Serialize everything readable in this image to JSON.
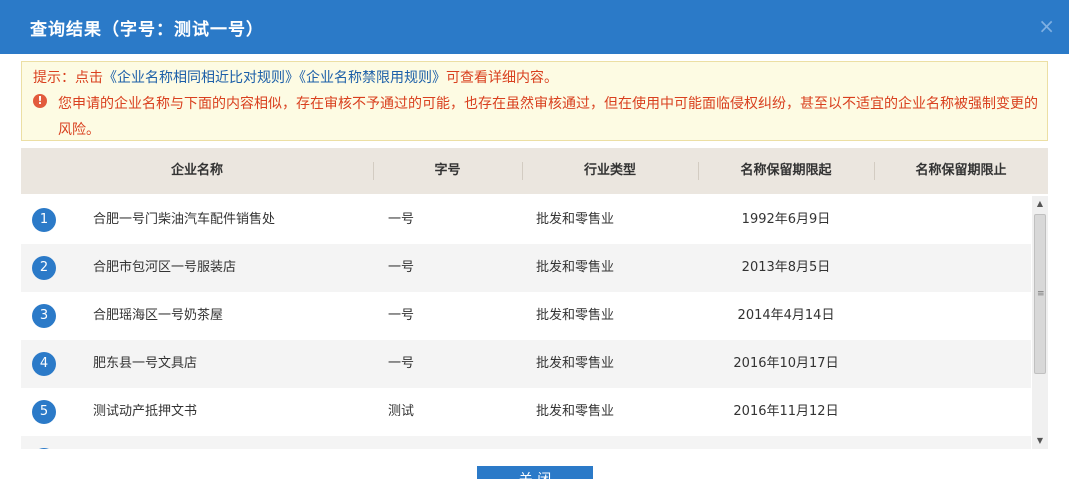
{
  "dialog": {
    "title": "查询结果（字号：测试一号）",
    "close_icon": "×"
  },
  "notice": {
    "prefix": "提示：点击",
    "link1": "《企业名称相同相近比对规则》",
    "link2": "《企业名称禁限用规则》",
    "suffix": "可查看详细内容。",
    "warn_icon": "!",
    "warning": "您申请的企业名称与下面的内容相似，存在审核不予通过的可能，也存在虽然审核通过，但在使用中可能面临侵权纠纷，甚至以不适宜的企业名称被强制变更的风险。"
  },
  "table": {
    "columns": [
      "企业名称",
      "字号",
      "行业类型",
      "名称保留期限起",
      "名称保留期限止"
    ],
    "rows": [
      {
        "num": "1",
        "name": "合肥一号门柴油汽车配件销售处",
        "zihao": "一号",
        "industry": "批发和零售业",
        "start": "1992年6月9日",
        "end": ""
      },
      {
        "num": "2",
        "name": "合肥市包河区一号服装店",
        "zihao": "一号",
        "industry": "批发和零售业",
        "start": "2013年8月5日",
        "end": ""
      },
      {
        "num": "3",
        "name": "合肥瑶海区一号奶茶屋",
        "zihao": "一号",
        "industry": "批发和零售业",
        "start": "2014年4月14日",
        "end": ""
      },
      {
        "num": "4",
        "name": "肥东县一号文具店",
        "zihao": "一号",
        "industry": "批发和零售业",
        "start": "2016年10月17日",
        "end": ""
      },
      {
        "num": "5",
        "name": "测试动产抵押文书",
        "zihao": "测试",
        "industry": "批发和零售业",
        "start": "2016年11月12日",
        "end": ""
      }
    ]
  },
  "scrollbar": {
    "up": "▲",
    "down": "▼",
    "grip": "≡"
  },
  "footer": {
    "close_label": "关 闭"
  },
  "colors": {
    "accent": "#2b7ac8",
    "warning_text": "#d9401f",
    "link": "#1c5fa8"
  }
}
